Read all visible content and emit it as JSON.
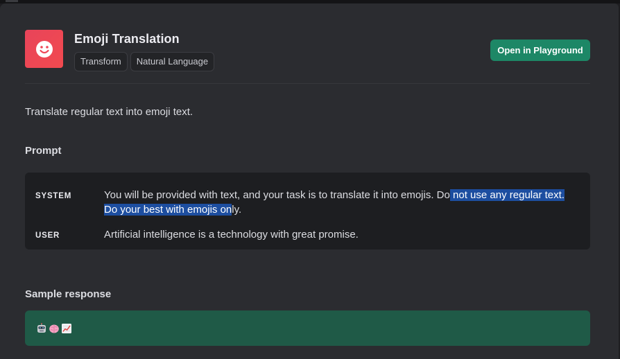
{
  "app": {
    "title": "Emoji Translation",
    "icon": "smiley-face-icon",
    "icon_color": "#ef4657",
    "tags": [
      "Transform",
      "Natural Language"
    ],
    "open_button_label": "Open in Playground",
    "accent": "#1d8766"
  },
  "description": "Translate regular text into emoji text.",
  "prompt": {
    "heading": "Prompt",
    "messages": [
      {
        "role": "SYSTEM",
        "text_before": "You will be provided with text, and your task is to translate it into emojis. Do",
        "text_selected": " not use any regular text. Do your best with emojis on",
        "text_after": "ly."
      },
      {
        "role": "USER",
        "text": "Artificial intelligence is a technology with great promise."
      }
    ]
  },
  "sample": {
    "heading": "Sample response",
    "emojis": [
      "robot-face-icon",
      "brain-icon",
      "chart-increasing-icon"
    ]
  }
}
